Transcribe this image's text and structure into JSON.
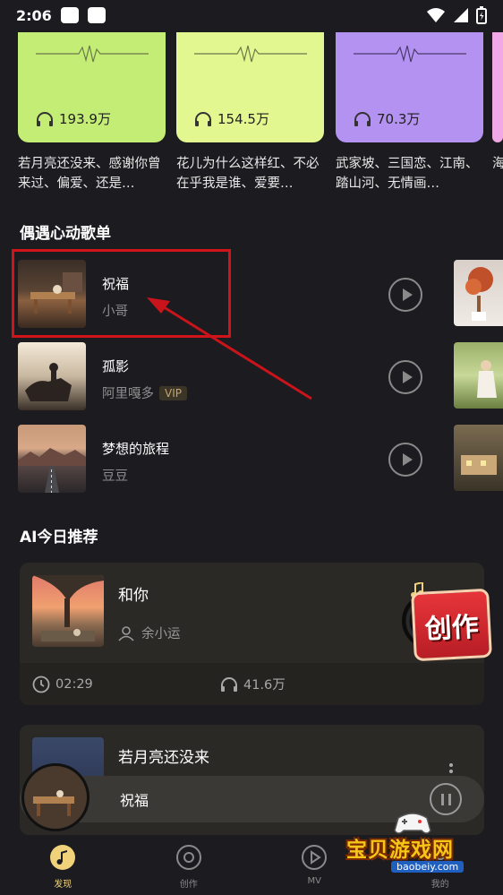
{
  "status_bar": {
    "time": "2:06"
  },
  "playlists": [
    {
      "count": "193.9万",
      "description": "若月亮还没来、感谢你曾来过、偏爱、还是…"
    },
    {
      "count": "154.5万",
      "description": "花儿为什么这样红、不必在乎我是谁、爱要…"
    },
    {
      "count": "70.3万",
      "description": "武家坡、三国恋、江南、踏山河、无情画…"
    },
    {
      "count": "",
      "description": "海的"
    }
  ],
  "encounter_section": {
    "title": "偶遇心动歌单",
    "songs": [
      {
        "title": "祝福",
        "artist": "小哥",
        "vip": ""
      },
      {
        "title": "孤影",
        "artist": "阿里嘎多",
        "vip": "VIP"
      },
      {
        "title": "梦想的旅程",
        "artist": "豆豆",
        "vip": ""
      }
    ]
  },
  "ai_section": {
    "title": "AI今日推荐",
    "cards": [
      {
        "title": "和你",
        "artist": "余小运",
        "duration": "02:29",
        "plays": "41.6万"
      },
      {
        "title": "若月亮还没来"
      }
    ]
  },
  "mini_player": {
    "title": "祝福"
  },
  "bottom_nav": [
    {
      "label": "发现",
      "active": true
    },
    {
      "label": "创作",
      "active": false
    },
    {
      "label": "MV",
      "active": false
    },
    {
      "label": "我的",
      "active": false
    }
  ],
  "overlay": {
    "create_badge": "创作",
    "watermark": "宝贝游戏网",
    "watermark_url": "baobeiy.com"
  },
  "colors": {
    "accent": "#f0d27a",
    "highlight": "#d0141a"
  }
}
